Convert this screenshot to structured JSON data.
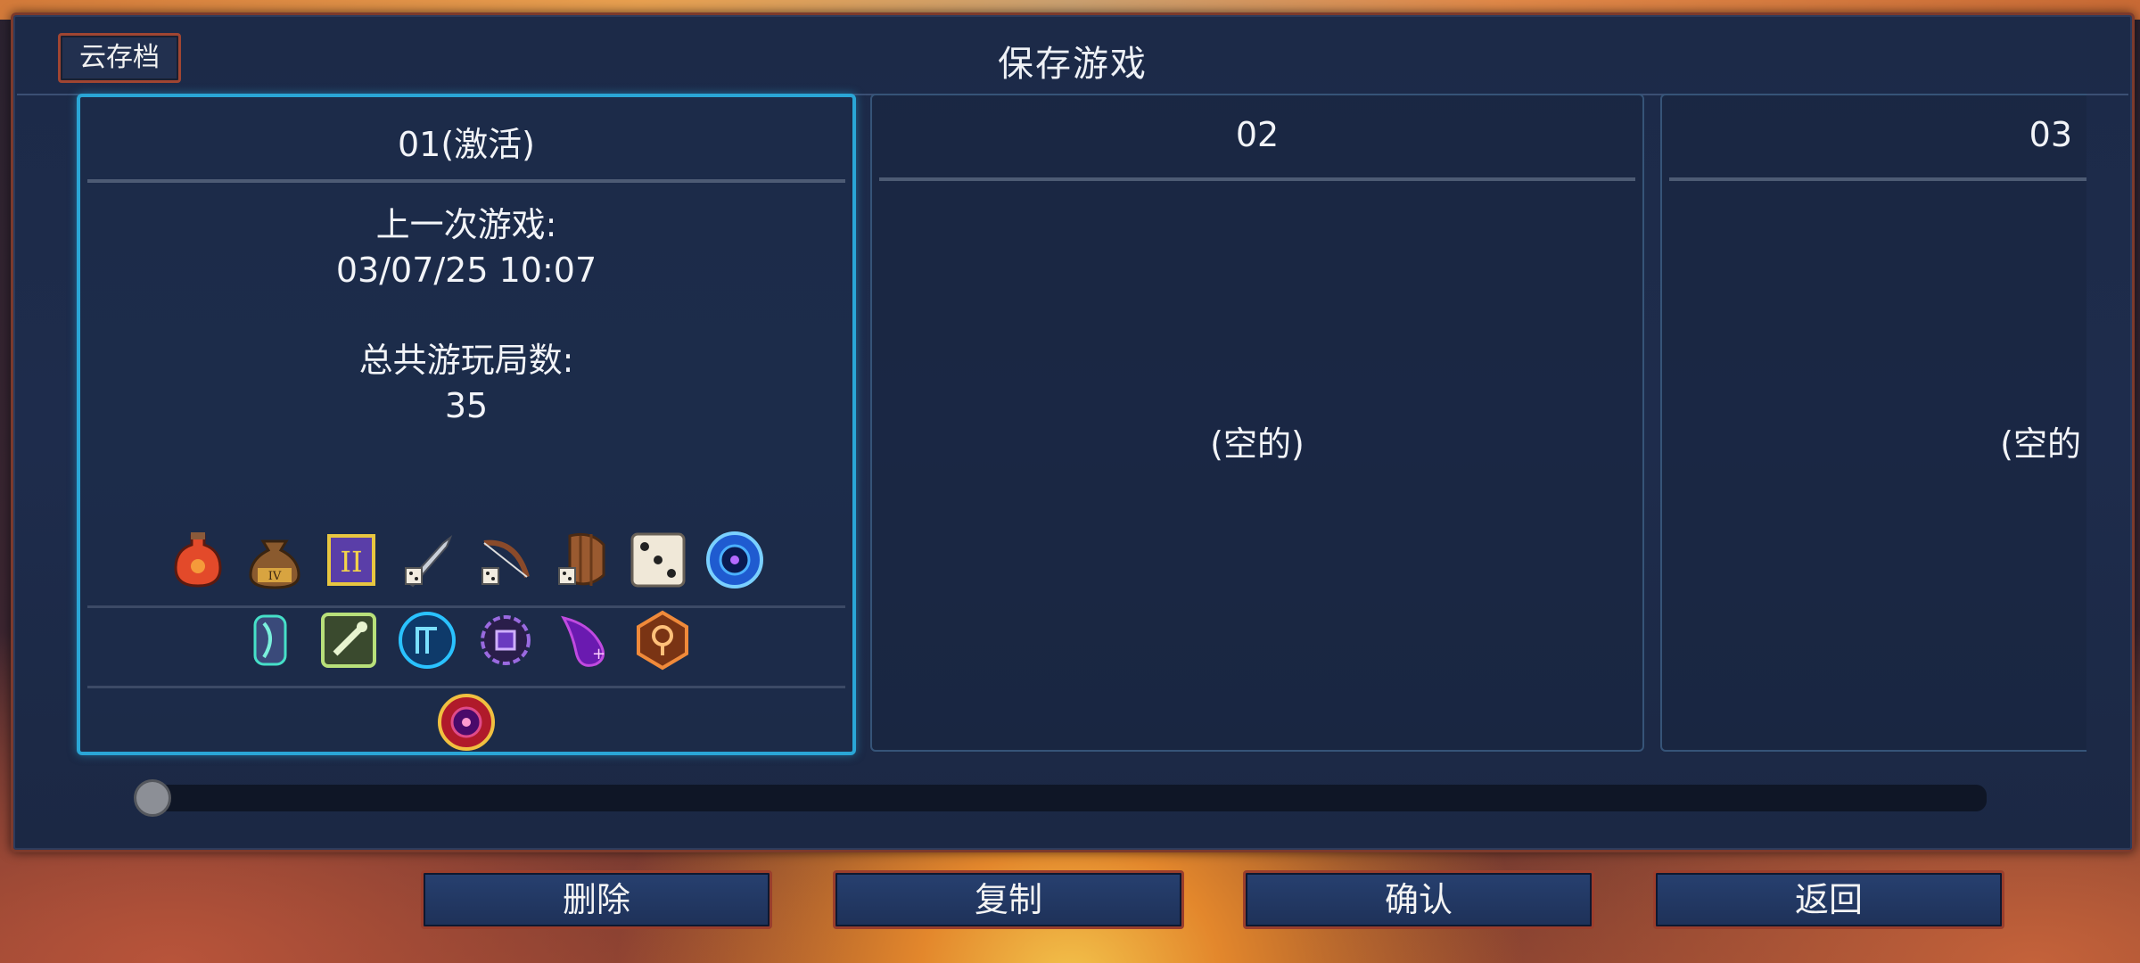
{
  "header": {
    "title": "保存游戏",
    "cloud_button": "云存档"
  },
  "slots": [
    {
      "title": "01(激活)",
      "last_played_label": "上一次游戏:",
      "last_played_value": "03/07/25 10:07",
      "total_runs_label": "总共游玩局数:",
      "total_runs_value": "35",
      "item_icons": [
        "red-potion-icon",
        "money-bag-icon",
        "scroll-icon",
        "sword-icon",
        "bow-icon",
        "shield-icon",
        "dice-icon",
        "blue-orb-icon"
      ],
      "rune_icons": [
        "vine-rune-icon",
        "wrench-rune-icon",
        "blue-rune-icon",
        "purple-gear-rune-icon",
        "purple-flame-rune-icon",
        "orange-rune-icon"
      ],
      "boss_cell_icon": "red-eye-orb-icon"
    },
    {
      "title": "02",
      "empty_label": "(空的)"
    },
    {
      "title": "03",
      "empty_label": "(空的"
    }
  ],
  "footer": {
    "delete_label": "删除",
    "copy_label": "复制",
    "confirm_label": "确认",
    "back_label": "返回"
  },
  "colors": {
    "panel_bg": "#1c2a48",
    "active_border": "#2aa6d6",
    "button_border": "#9a3e2c",
    "button_bg": "#274070"
  },
  "scroll": {
    "position": 0.0
  }
}
